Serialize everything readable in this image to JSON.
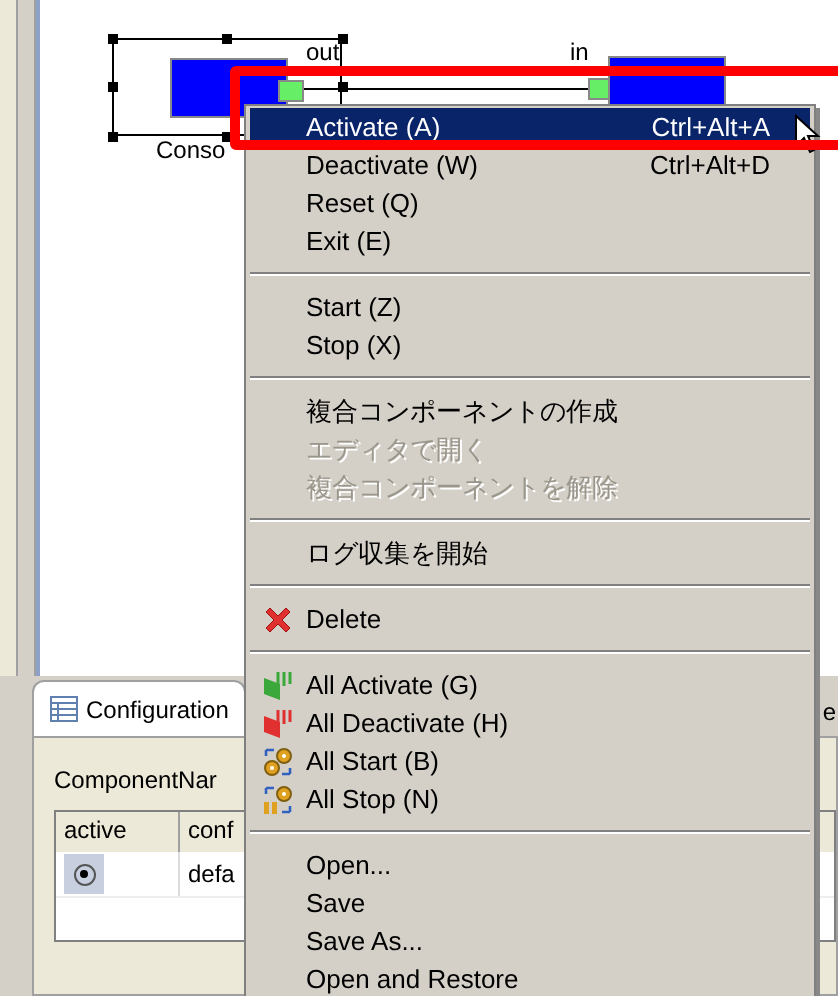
{
  "diagram": {
    "components": [
      {
        "label": "Conso",
        "port": "out"
      },
      {
        "port": "in"
      }
    ]
  },
  "bottom_panel": {
    "tabs": [
      {
        "label": "Configuration",
        "selected": true
      },
      {
        "label": "e",
        "selected": false
      }
    ],
    "field_label": "ComponentNar",
    "table": {
      "columns": [
        "active",
        "conf"
      ],
      "rows": [
        {
          "cells": [
            {
              "kind": "radio",
              "selected": true
            },
            {
              "kind": "text",
              "text": "defa"
            }
          ]
        }
      ]
    }
  },
  "context_menu": {
    "items": [
      {
        "kind": "item",
        "label": "Activate (A)",
        "shortcut": "Ctrl+Alt+A",
        "selected": true,
        "disabled": false
      },
      {
        "kind": "item",
        "label": "Deactivate (W)",
        "shortcut": "Ctrl+Alt+D",
        "selected": false,
        "disabled": false
      },
      {
        "kind": "item",
        "label": "Reset (Q)",
        "selected": false,
        "disabled": false
      },
      {
        "kind": "item",
        "label": "Exit (E)",
        "selected": false,
        "disabled": false
      },
      {
        "kind": "separator"
      },
      {
        "kind": "item",
        "label": "Start (Z)",
        "selected": false,
        "disabled": false
      },
      {
        "kind": "item",
        "label": "Stop (X)",
        "selected": false,
        "disabled": false
      },
      {
        "kind": "separator"
      },
      {
        "kind": "item",
        "label": "複合コンポーネントの作成",
        "selected": false,
        "disabled": false
      },
      {
        "kind": "item",
        "label": "エディタで開く",
        "selected": false,
        "disabled": true
      },
      {
        "kind": "item",
        "label": "複合コンポーネントを解除",
        "selected": false,
        "disabled": true
      },
      {
        "kind": "separator"
      },
      {
        "kind": "item",
        "label": "ログ収集を開始",
        "selected": false,
        "disabled": false
      },
      {
        "kind": "separator"
      },
      {
        "kind": "delete",
        "label": "Delete",
        "selected": false,
        "disabled": false
      },
      {
        "kind": "separator"
      },
      {
        "kind": "activate-all",
        "label": "All Activate (G)",
        "selected": false,
        "disabled": false
      },
      {
        "kind": "deactivate-all",
        "label": "All Deactivate (H)",
        "selected": false,
        "disabled": false
      },
      {
        "kind": "start-all",
        "label": "All Start (B)",
        "selected": false,
        "disabled": false
      },
      {
        "kind": "stop-all",
        "label": "All Stop (N)",
        "selected": false,
        "disabled": false
      },
      {
        "kind": "separator"
      },
      {
        "kind": "item",
        "label": "Open...",
        "selected": false,
        "disabled": false
      },
      {
        "kind": "item",
        "label": "Save",
        "selected": false,
        "disabled": false
      },
      {
        "kind": "item",
        "label": "Save As...",
        "selected": false,
        "disabled": false
      },
      {
        "kind": "item",
        "label": "Open and Restore",
        "selected": false,
        "disabled": false
      }
    ]
  }
}
